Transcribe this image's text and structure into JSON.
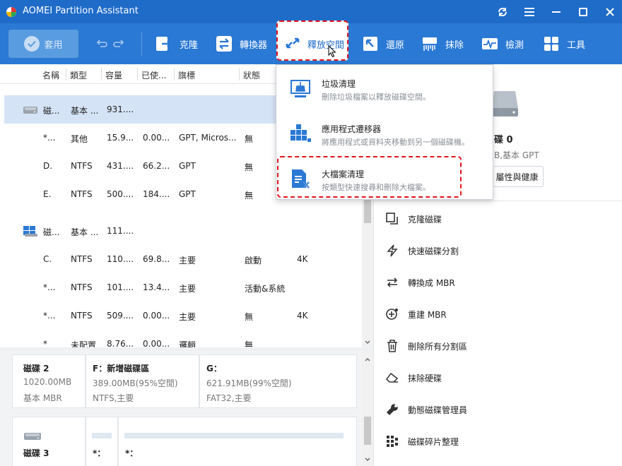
{
  "window": {
    "title": "AOMEI Partition Assistant"
  },
  "toolbar": {
    "apply_label": "套用",
    "items": [
      {
        "label": "克隆",
        "icon": "clone-icon"
      },
      {
        "label": "轉換器",
        "icon": "converter-icon"
      },
      {
        "label": "釋放空間",
        "icon": "free-space-icon"
      },
      {
        "label": "還原",
        "icon": "restore-icon"
      },
      {
        "label": "抹除",
        "icon": "wipe-icon"
      },
      {
        "label": "檢測",
        "icon": "check-icon"
      },
      {
        "label": "工具",
        "icon": "tools-icon"
      }
    ]
  },
  "table": {
    "headers": [
      "名稱",
      "類型",
      "容量",
      "已使...",
      "旗標",
      "狀態"
    ],
    "rows": [
      {
        "name": "磁...",
        "type": "基本 ...",
        "cap": "931....",
        "used": "",
        "flag": "",
        "status": "",
        "extra": "",
        "icon": "disk-icon",
        "selected": true
      },
      {
        "name": "*...",
        "type": "其他",
        "cap": "15.9...",
        "used": "0.00...",
        "flag": "GPT, Micros...",
        "status": "無",
        "extra": ""
      },
      {
        "name": "D.",
        "type": "NTFS",
        "cap": "431....",
        "used": "66.2...",
        "flag": "GPT",
        "status": "無",
        "extra": ""
      },
      {
        "name": "E.",
        "type": "NTFS",
        "cap": "500....",
        "used": "184....",
        "flag": "GPT",
        "status": "無",
        "extra": ""
      },
      {
        "name": "磁...",
        "type": "基本 ...",
        "cap": "111....",
        "used": "",
        "flag": "",
        "status": "",
        "extra": "",
        "icon": "windows-disk-icon"
      },
      {
        "name": "C.",
        "type": "NTFS",
        "cap": "110....",
        "used": "69.8...",
        "flag": "主要",
        "status": "啟動",
        "extra": "4K"
      },
      {
        "name": "*...",
        "type": "NTFS",
        "cap": "101....",
        "used": "13.4...",
        "flag": "主要",
        "status": "活動&系統",
        "extra": ""
      },
      {
        "name": "*...",
        "type": "NTFS",
        "cap": "509....",
        "used": "0.00...",
        "flag": "主要",
        "status": "無",
        "extra": "4K"
      },
      {
        "name": "*",
        "type": "未配置",
        "cap": "8.76...",
        "used": "0.00...",
        "flag": "邏輯",
        "status": "無",
        "extra": ""
      }
    ]
  },
  "diskmap": {
    "disk2": {
      "name": "磁碟 2",
      "size": "1020.00MB",
      "kind": "基本 MBR"
    },
    "partF": {
      "name": "F：新增磁碟區",
      "size": "389.00MB(95%空閒)",
      "fs": "NTFS,主要"
    },
    "partG": {
      "name": "G：",
      "size": "621.91MB(99%空閒)",
      "fs": "FAT32,主要"
    },
    "disk3": {
      "name": "磁碟 3",
      "p1": "*：",
      "p2": "*："
    }
  },
  "rightpanel": {
    "disk_name": "碟 0",
    "disk_info": "B,基本 GPT",
    "props_button": "屬性與健康",
    "operations": [
      {
        "label": "克隆磁碟",
        "icon": "clone-disk-icon"
      },
      {
        "label": "快速磁碟分割",
        "icon": "lightning-icon"
      },
      {
        "label": "轉換成 MBR",
        "icon": "convert-arrows-icon"
      },
      {
        "label": "重建 MBR",
        "icon": "rebuild-plus-icon"
      },
      {
        "label": "刪除所有分割區",
        "icon": "trash-icon"
      },
      {
        "label": "抹除硬碟",
        "icon": "eraser-icon"
      },
      {
        "label": "動態磁碟管理員",
        "icon": "wrench-icon"
      },
      {
        "label": "磁碟碎片整理",
        "icon": "defrag-icon"
      }
    ]
  },
  "dropdown": {
    "items": [
      {
        "title": "垃圾清理",
        "desc": "刪除垃圾檔案以釋放磁碟空間。",
        "icon": "broom-icon"
      },
      {
        "title": "應用程式遷移器",
        "desc": "將應用程式或資料夾移動到另一個磁碟機。",
        "icon": "app-mover-icon"
      },
      {
        "title": "大檔案清理",
        "desc": "按類型快速搜尋和刪除大檔案。",
        "icon": "large-file-icon"
      }
    ]
  },
  "colors": {
    "titlebar": "#1f6bc8",
    "toolbar": "#2a79d4",
    "highlight": "#e0141a",
    "selected_row": "#d5e3f6"
  }
}
